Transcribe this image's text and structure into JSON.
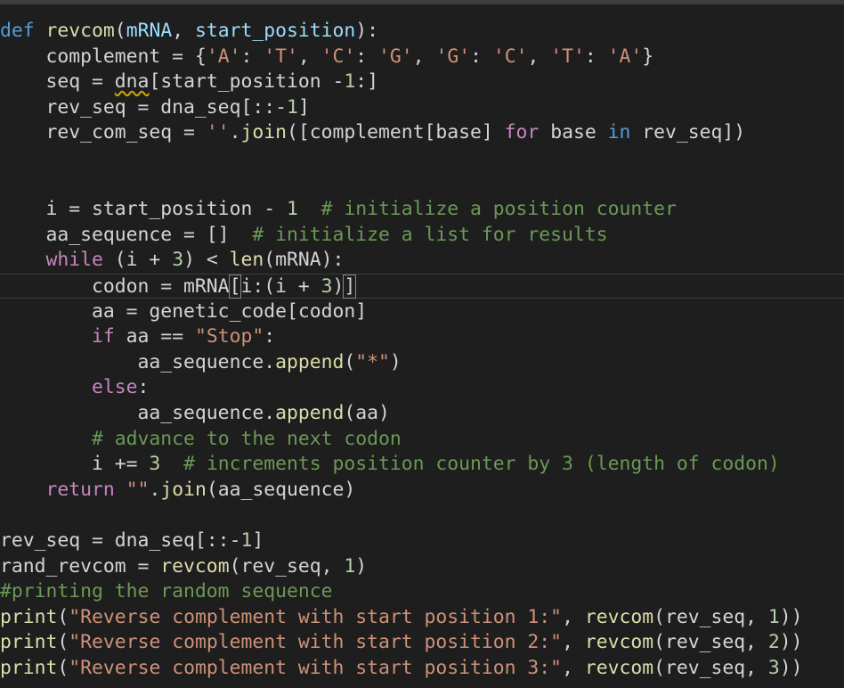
{
  "editor": {
    "language": "python",
    "lines": [
      [
        [
          "kw",
          "def "
        ],
        [
          "fn",
          "revcom"
        ],
        [
          "plain",
          "("
        ],
        [
          "param",
          "mRNA"
        ],
        [
          "plain",
          ", "
        ],
        [
          "param",
          "start_position"
        ],
        [
          "plain",
          "):"
        ]
      ],
      [
        [
          "plain",
          "    complement = {"
        ],
        [
          "str",
          "'A'"
        ],
        [
          "plain",
          ": "
        ],
        [
          "str",
          "'T'"
        ],
        [
          "plain",
          ", "
        ],
        [
          "str",
          "'C'"
        ],
        [
          "plain",
          ": "
        ],
        [
          "str",
          "'G'"
        ],
        [
          "plain",
          ", "
        ],
        [
          "str",
          "'G'"
        ],
        [
          "plain",
          ": "
        ],
        [
          "str",
          "'C'"
        ],
        [
          "plain",
          ", "
        ],
        [
          "str",
          "'T'"
        ],
        [
          "plain",
          ": "
        ],
        [
          "str",
          "'A'"
        ],
        [
          "plain",
          "}"
        ]
      ],
      [
        [
          "plain",
          "    seq = "
        ],
        [
          "squiggle",
          "dna"
        ],
        [
          "plain",
          "[start_position "
        ],
        [
          "plain",
          "-"
        ],
        [
          "num",
          "1"
        ],
        [
          "plain",
          ":]"
        ]
      ],
      [
        [
          "plain",
          "    rev_seq = dna_seq[::"
        ],
        [
          "plain",
          "-"
        ],
        [
          "num",
          "1"
        ],
        [
          "plain",
          "]"
        ]
      ],
      [
        [
          "plain",
          "    rev_com_seq = "
        ],
        [
          "str",
          "''"
        ],
        [
          "plain",
          "."
        ],
        [
          "fn",
          "join"
        ],
        [
          "plain",
          "([complement[base] "
        ],
        [
          "ctl",
          "for"
        ],
        [
          "plain",
          " base "
        ],
        [
          "kw",
          "in"
        ],
        [
          "plain",
          " rev_seq])"
        ]
      ],
      [],
      [],
      [
        [
          "plain",
          "    i = start_position - "
        ],
        [
          "num",
          "1"
        ],
        [
          "plain",
          "  "
        ],
        [
          "com",
          "# initialize a position counter"
        ]
      ],
      [
        [
          "plain",
          "    aa_sequence = []  "
        ],
        [
          "com",
          "# initialize a list for results"
        ]
      ],
      [
        [
          "plain",
          "    "
        ],
        [
          "ctl",
          "while"
        ],
        [
          "plain",
          " (i + "
        ],
        [
          "num",
          "3"
        ],
        [
          "plain",
          ") < "
        ],
        [
          "fn",
          "len"
        ],
        [
          "plain",
          "(mRNA):"
        ]
      ],
      [
        [
          "plain",
          "        codon = mRNA"
        ],
        [
          "bm",
          "["
        ],
        [
          "plain",
          "i:(i + "
        ],
        [
          "num",
          "3"
        ],
        [
          "plain",
          ")"
        ],
        [
          "bm",
          "]"
        ]
      ],
      [
        [
          "plain",
          "        aa = genetic_code[codon]"
        ]
      ],
      [
        [
          "plain",
          "        "
        ],
        [
          "ctl",
          "if"
        ],
        [
          "plain",
          " aa == "
        ],
        [
          "str",
          "\"Stop\""
        ],
        [
          "plain",
          ":"
        ]
      ],
      [
        [
          "plain",
          "            aa_sequence."
        ],
        [
          "fn",
          "append"
        ],
        [
          "plain",
          "("
        ],
        [
          "str",
          "\"*\""
        ],
        [
          "plain",
          ")"
        ]
      ],
      [
        [
          "plain",
          "        "
        ],
        [
          "ctl",
          "else"
        ],
        [
          "plain",
          ":"
        ]
      ],
      [
        [
          "plain",
          "            aa_sequence."
        ],
        [
          "fn",
          "append"
        ],
        [
          "plain",
          "(aa)"
        ]
      ],
      [
        [
          "plain",
          "        "
        ],
        [
          "com",
          "# advance to the next codon"
        ]
      ],
      [
        [
          "plain",
          "        i += "
        ],
        [
          "num",
          "3"
        ],
        [
          "plain",
          "  "
        ],
        [
          "com",
          "# increments position counter by 3 (length of codon)"
        ]
      ],
      [
        [
          "plain",
          "    "
        ],
        [
          "ctl",
          "return"
        ],
        [
          "plain",
          " "
        ],
        [
          "str",
          "\"\""
        ],
        [
          "plain",
          "."
        ],
        [
          "fn",
          "join"
        ],
        [
          "plain",
          "(aa_sequence)"
        ]
      ],
      [],
      [
        [
          "plain",
          "rev_seq = dna_seq[::"
        ],
        [
          "plain",
          "-"
        ],
        [
          "num",
          "1"
        ],
        [
          "plain",
          "]"
        ]
      ],
      [
        [
          "plain",
          "rand_revcom = "
        ],
        [
          "fn",
          "revcom"
        ],
        [
          "plain",
          "(rev_seq, "
        ],
        [
          "num",
          "1"
        ],
        [
          "plain",
          ")"
        ]
      ],
      [
        [
          "com",
          "#printing the random sequence"
        ]
      ],
      [
        [
          "fn",
          "print"
        ],
        [
          "plain",
          "("
        ],
        [
          "str",
          "\"Reverse complement with start position 1:\""
        ],
        [
          "plain",
          ", "
        ],
        [
          "fn",
          "revcom"
        ],
        [
          "plain",
          "(rev_seq, "
        ],
        [
          "num",
          "1"
        ],
        [
          "plain",
          "))"
        ]
      ],
      [
        [
          "fn",
          "print"
        ],
        [
          "plain",
          "("
        ],
        [
          "str",
          "\"Reverse complement with start position 2:\""
        ],
        [
          "plain",
          ", "
        ],
        [
          "fn",
          "revcom"
        ],
        [
          "plain",
          "(rev_seq, "
        ],
        [
          "num",
          "2"
        ],
        [
          "plain",
          "))"
        ]
      ],
      [
        [
          "fn",
          "print"
        ],
        [
          "plain",
          "("
        ],
        [
          "str",
          "\"Reverse complement with start position 3:\""
        ],
        [
          "plain",
          ", "
        ],
        [
          "fn",
          "revcom"
        ],
        [
          "plain",
          "(rev_seq, "
        ],
        [
          "num",
          "3"
        ],
        [
          "plain",
          "))"
        ]
      ]
    ],
    "current_line_index": 10,
    "colors": {
      "background": "#1e1e1e",
      "keyword": "#569cd6",
      "control": "#c586c0",
      "function": "#dcdcaa",
      "parameter": "#9cdcfe",
      "string": "#ce9178",
      "number": "#b5cea8",
      "comment": "#6a9955",
      "text": "#d4d4d4"
    }
  }
}
